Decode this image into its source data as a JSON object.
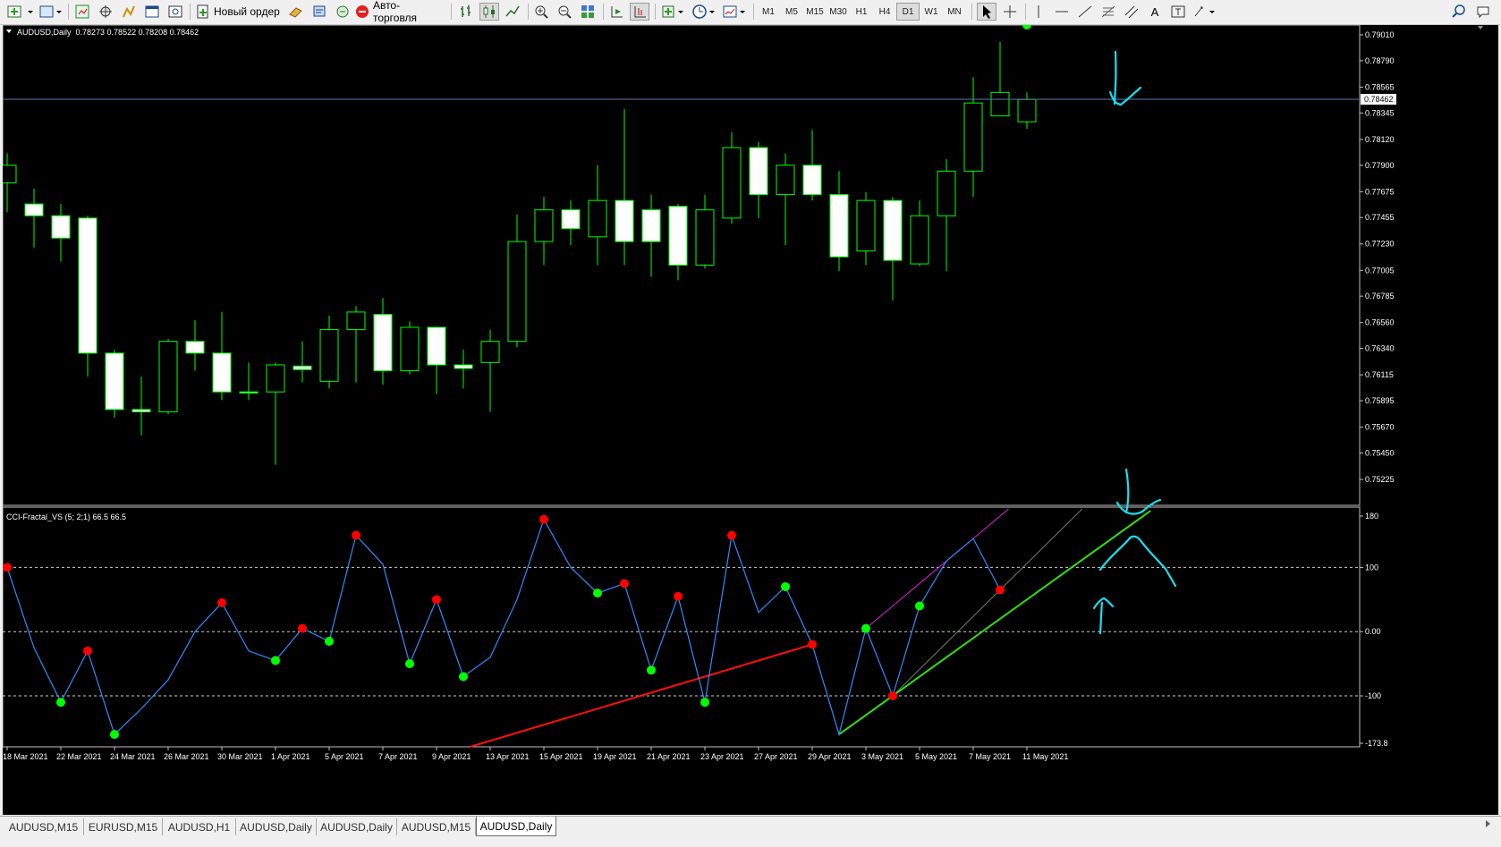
{
  "toolbar": {
    "new_order_label": "Новый ордер",
    "autotrading_label": "Авто-торговля",
    "timeframes": [
      "M1",
      "M5",
      "M15",
      "M30",
      "H1",
      "H4",
      "D1",
      "W1",
      "MN"
    ],
    "active_timeframe": "D1"
  },
  "main_chart": {
    "info_label": "AUDUSD,Daily",
    "ohlc_label": "0.78273 0.78522 0.78208 0.78462",
    "price_ticks": [
      "0.79010",
      "0.78790",
      "0.78565",
      "0.78345",
      "0.78120",
      "0.77900",
      "0.77675",
      "0.77455",
      "0.77230",
      "0.77005",
      "0.76785",
      "0.76560",
      "0.76340",
      "0.76115",
      "0.75895",
      "0.75670",
      "0.75450",
      "0.75225"
    ],
    "current_price_label": "0.78462"
  },
  "indicator": {
    "info_label": "CCI-Fractal_VS (5; 2;1) 66.5 66.5",
    "ticks": [
      "180",
      "100",
      "0.00",
      "-100",
      "-173.8"
    ]
  },
  "time_axis": {
    "labels": [
      "18 Mar 2021",
      "22 Mar 2021",
      "24 Mar 2021",
      "26 Mar 2021",
      "30 Mar 2021",
      "1 Apr 2021",
      "5 Apr 2021",
      "7 Apr 2021",
      "9 Apr 2021",
      "13 Apr 2021",
      "15 Apr 2021",
      "19 Apr 2021",
      "21 Apr 2021",
      "23 Apr 2021",
      "27 Apr 2021",
      "29 Apr 2021",
      "3 May 2021",
      "5 May 2021",
      "7 May 2021",
      "11 May 2021"
    ]
  },
  "chart_data": {
    "type": "candlestick",
    "symbol": "AUDUSD",
    "timeframe": "Daily",
    "price_range": [
      0.75225,
      0.7901
    ],
    "candles": [
      {
        "o": 0.7775,
        "h": 0.78,
        "l": 0.775,
        "c": 0.779
      },
      {
        "o": 0.7757,
        "h": 0.777,
        "l": 0.772,
        "c": 0.7747
      },
      {
        "o": 0.7747,
        "h": 0.7757,
        "l": 0.7708,
        "c": 0.7728
      },
      {
        "o": 0.7745,
        "h": 0.7747,
        "l": 0.761,
        "c": 0.763
      },
      {
        "o": 0.763,
        "h": 0.7633,
        "l": 0.7575,
        "c": 0.7582
      },
      {
        "o": 0.7582,
        "h": 0.761,
        "l": 0.756,
        "c": 0.758
      },
      {
        "o": 0.758,
        "h": 0.7642,
        "l": 0.7578,
        "c": 0.764
      },
      {
        "o": 0.764,
        "h": 0.7658,
        "l": 0.7615,
        "c": 0.763
      },
      {
        "o": 0.763,
        "h": 0.7665,
        "l": 0.759,
        "c": 0.7597
      },
      {
        "o": 0.7597,
        "h": 0.7622,
        "l": 0.759,
        "c": 0.7596
      },
      {
        "o": 0.7597,
        "h": 0.7622,
        "l": 0.7535,
        "c": 0.762
      },
      {
        "o": 0.7619,
        "h": 0.764,
        "l": 0.7605,
        "c": 0.7616
      },
      {
        "o": 0.7606,
        "h": 0.7662,
        "l": 0.76,
        "c": 0.765
      },
      {
        "o": 0.765,
        "h": 0.767,
        "l": 0.7605,
        "c": 0.7665
      },
      {
        "o": 0.7663,
        "h": 0.7677,
        "l": 0.7603,
        "c": 0.7615
      },
      {
        "o": 0.7615,
        "h": 0.7657,
        "l": 0.7612,
        "c": 0.7652
      },
      {
        "o": 0.7652,
        "h": 0.7652,
        "l": 0.7595,
        "c": 0.762
      },
      {
        "o": 0.762,
        "h": 0.7633,
        "l": 0.76,
        "c": 0.7617
      },
      {
        "o": 0.7622,
        "h": 0.765,
        "l": 0.758,
        "c": 0.764
      },
      {
        "o": 0.764,
        "h": 0.7748,
        "l": 0.7635,
        "c": 0.7725
      },
      {
        "o": 0.7725,
        "h": 0.7763,
        "l": 0.7705,
        "c": 0.7752
      },
      {
        "o": 0.7752,
        "h": 0.776,
        "l": 0.7722,
        "c": 0.7736
      },
      {
        "o": 0.7729,
        "h": 0.779,
        "l": 0.7705,
        "c": 0.776
      },
      {
        "o": 0.776,
        "h": 0.7838,
        "l": 0.7705,
        "c": 0.7725
      },
      {
        "o": 0.7752,
        "h": 0.7765,
        "l": 0.7695,
        "c": 0.7725
      },
      {
        "o": 0.7755,
        "h": 0.7757,
        "l": 0.7692,
        "c": 0.7705
      },
      {
        "o": 0.7705,
        "h": 0.7765,
        "l": 0.7702,
        "c": 0.7752
      },
      {
        "o": 0.7745,
        "h": 0.7818,
        "l": 0.774,
        "c": 0.7805
      },
      {
        "o": 0.7805,
        "h": 0.781,
        "l": 0.7745,
        "c": 0.7765
      },
      {
        "o": 0.7765,
        "h": 0.78,
        "l": 0.7722,
        "c": 0.779
      },
      {
        "o": 0.779,
        "h": 0.782,
        "l": 0.776,
        "c": 0.7765
      },
      {
        "o": 0.7765,
        "h": 0.7785,
        "l": 0.77,
        "c": 0.7712
      },
      {
        "o": 0.7717,
        "h": 0.7767,
        "l": 0.7705,
        "c": 0.776
      },
      {
        "o": 0.776,
        "h": 0.7763,
        "l": 0.7675,
        "c": 0.7709
      },
      {
        "o": 0.7706,
        "h": 0.776,
        "l": 0.7704,
        "c": 0.7747
      },
      {
        "o": 0.7747,
        "h": 0.7795,
        "l": 0.77,
        "c": 0.7785
      },
      {
        "o": 0.7785,
        "h": 0.7865,
        "l": 0.7763,
        "c": 0.7843
      },
      {
        "o": 0.7832,
        "h": 0.7895,
        "l": 0.7832,
        "c": 0.7852
      },
      {
        "o": 0.7827,
        "h": 0.7852,
        "l": 0.7821,
        "c": 0.7846
      }
    ],
    "cci_range": [
      -173.8,
      180
    ],
    "cci_levels": [
      100,
      0,
      -100
    ],
    "cci_values": [
      100,
      -25,
      -110,
      -30,
      -160,
      -120,
      -75,
      0,
      45,
      -30,
      -45,
      5,
      -15,
      150,
      105,
      -50,
      50,
      -70,
      -40,
      50,
      175,
      100,
      60,
      75,
      -60,
      55,
      -110,
      150,
      30,
      70,
      -20,
      -160,
      5,
      -100,
      40,
      110,
      145,
      65
    ],
    "fractals_up": [
      0,
      3,
      8,
      11,
      13,
      16,
      20,
      23,
      25,
      27,
      30,
      33,
      37
    ],
    "fractals_down": [
      2,
      4,
      10,
      12,
      15,
      17,
      22,
      24,
      26,
      29,
      32,
      34,
      38
    ]
  }
}
